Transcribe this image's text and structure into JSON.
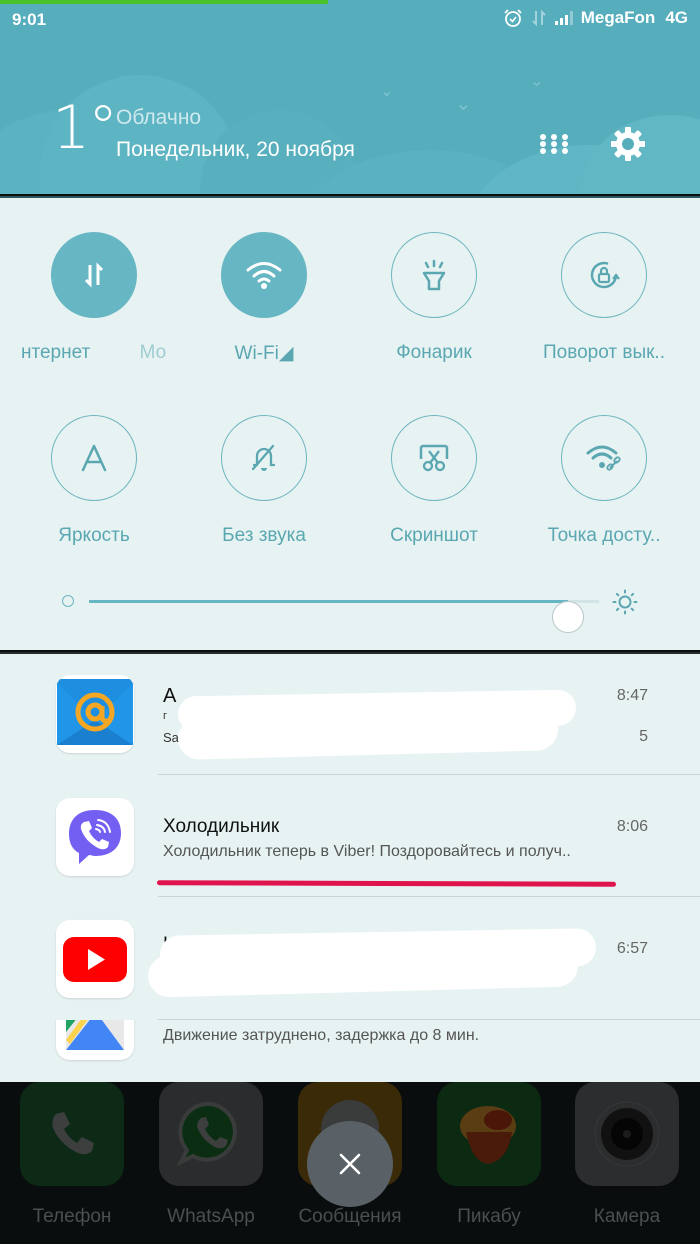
{
  "status_bar": {
    "time": "9:01",
    "icons": [
      "alarm-icon",
      "data-arrows-icon",
      "signal-icon"
    ],
    "carrier": "MegaFon",
    "network": "4G"
  },
  "weather": {
    "temperature": "1°",
    "condition": "Облачно",
    "date": "Понедельник, 20 ноября",
    "actions": [
      "more-icon",
      "gear-icon"
    ]
  },
  "quick_settings": {
    "tiles": [
      {
        "label": "нтернет",
        "partial_label": "Мо",
        "icon": "mobile-data-icon",
        "active": true
      },
      {
        "label": "Wi-Fi◢",
        "icon": "wifi-icon",
        "active": true
      },
      {
        "label": "Фонарик",
        "icon": "flashlight-icon",
        "active": false
      },
      {
        "label": "Поворот вык..",
        "icon": "rotation-lock-icon",
        "active": false
      },
      {
        "label": "Яркость",
        "icon": "auto-brightness-icon",
        "active": false
      },
      {
        "label": "Без звука",
        "icon": "bell-off-icon",
        "active": false
      },
      {
        "label": "Скриншот",
        "icon": "screenshot-icon",
        "active": false
      },
      {
        "label": "Точка досту..",
        "icon": "hotspot-icon",
        "active": false
      }
    ],
    "brightness": {
      "value_percent": 94,
      "min_icon": "brightness-low-icon",
      "max_icon": "brightness-high-icon"
    }
  },
  "notifications": [
    {
      "app": "Mail.Ru",
      "icon": "mail-app-icon",
      "title": "А",
      "line1": "г",
      "line2": "Sa",
      "time": "8:47",
      "count": "5",
      "redacted": true
    },
    {
      "app": "Viber",
      "icon": "viber-app-icon",
      "title": "Холодильник",
      "text": "Холодильник теперь в Viber! Поздоровайтесь и получ..",
      "time": "8:06",
      "highlighted": true,
      "highlight_color": "#e0144c"
    },
    {
      "app": "YouTube",
      "icon": "youtube-app-icon",
      "title": "Н",
      "text": "",
      "time": "6:57",
      "redacted": true
    },
    {
      "app": "Maps",
      "icon": "maps-app-icon",
      "text": "Движение затруднено, задержка до 8 мин."
    }
  ],
  "dock": {
    "apps": [
      {
        "label": "Телефон",
        "icon": "phone-icon"
      },
      {
        "label": "WhatsApp",
        "icon": "whatsapp-icon"
      },
      {
        "label": "Сообщения",
        "icon": "messages-icon"
      },
      {
        "label": "Пикабу",
        "icon": "pikabu-icon"
      },
      {
        "label": "Камера",
        "icon": "camera-icon"
      }
    ],
    "close_icon": "close-icon"
  },
  "colors": {
    "accent": "#66b6c3",
    "header_bg": "#56aebd",
    "panel_bg": "#e7f2f2",
    "progress_green": "#49c12a"
  }
}
